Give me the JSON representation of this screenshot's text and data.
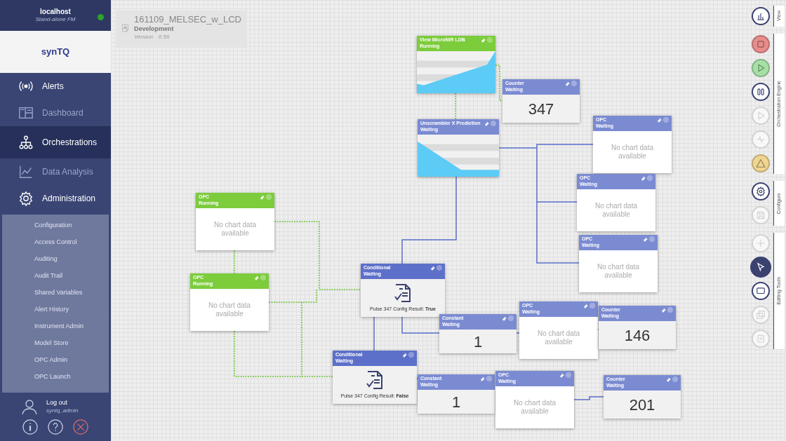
{
  "sidebar": {
    "host": {
      "name": "localhost",
      "mode": "Stand-alone FM",
      "online": true
    },
    "logo": "synTQ",
    "nav": [
      {
        "label": "Alerts",
        "kind": "alerts",
        "selected": false,
        "dim": false
      },
      {
        "label": "Dashboard",
        "kind": "dashboard",
        "selected": false,
        "dim": true
      },
      {
        "label": "Orchestrations",
        "kind": "orchestrations",
        "selected": true,
        "dim": false
      },
      {
        "label": "Data Analysis",
        "kind": "analysis",
        "selected": false,
        "dim": true
      },
      {
        "label": "Administration",
        "kind": "admin",
        "selected": false,
        "dim": false
      }
    ],
    "submenu": [
      "Configuration",
      "Access Control",
      "Auditing",
      "Audit Trail",
      "Shared Variables",
      "Alert History",
      "Instrument Admin",
      "Model Store",
      "OPC Admin",
      "OPC Launch"
    ],
    "user": {
      "action": "Log out",
      "name": "syntq_admin"
    }
  },
  "document": {
    "title": "161109_MELSEC_w_LCD",
    "stage": "Development",
    "version_label": "Version",
    "version": "0.56"
  },
  "nodes": [
    {
      "kind": "risingchart",
      "title": "View MicroNIR LDB",
      "status": "Running",
      "running": true
    },
    {
      "kind": "value",
      "title": "Counter",
      "status": "Waiting",
      "running": false,
      "value": "347"
    },
    {
      "kind": "fallingchart",
      "title": "Unscrambler X Prediction",
      "status": "Waiting",
      "running": false
    },
    {
      "kind": "empty",
      "title": "OPC",
      "status": "Waiting",
      "running": false,
      "message": "No chart data available"
    },
    {
      "kind": "empty",
      "title": "OPC",
      "status": "Waiting",
      "running": false,
      "message": "No chart data available"
    },
    {
      "kind": "empty",
      "title": "OPC",
      "status": "Running",
      "running": true,
      "message": "No chart data available"
    },
    {
      "kind": "empty",
      "title": "OPC",
      "status": "Waiting",
      "running": false,
      "message": "No chart data available"
    },
    {
      "kind": "empty",
      "title": "OPC",
      "status": "Running",
      "running": true,
      "message": "No chart data available"
    },
    {
      "kind": "conditional",
      "title": "Conditional",
      "status": "Waiting",
      "running": false,
      "result": "Pulse 347 Config Result: **True**"
    },
    {
      "kind": "value",
      "title": "Constant",
      "status": "Waiting",
      "running": false,
      "value": "1"
    },
    {
      "kind": "empty",
      "title": "OPC",
      "status": "Waiting",
      "running": false,
      "message": "No chart data available"
    },
    {
      "kind": "value",
      "title": "Counter",
      "status": "Waiting",
      "running": false,
      "value": "146"
    },
    {
      "kind": "conditional",
      "title": "Conditional",
      "status": "Waiting",
      "running": false,
      "result": "Pulse 347 Config Result: **False**"
    },
    {
      "kind": "value",
      "title": "Constant",
      "status": "Waiting",
      "running": false,
      "value": "1"
    },
    {
      "kind": "empty",
      "title": "OPC",
      "status": "Waiting",
      "running": false,
      "message": "No chart data available"
    },
    {
      "kind": "value",
      "title": "Counter",
      "status": "Waiting",
      "running": false,
      "value": "201"
    }
  ],
  "toolbar": [
    {
      "label": "View",
      "tools": [
        {
          "kind": "chart",
          "disabled": false
        }
      ]
    },
    {
      "label": "Orchestration Engine",
      "tools": [
        {
          "kind": "stop",
          "color": "#e88c8c",
          "disabled": false
        },
        {
          "kind": "play",
          "color": "#a6e0a6",
          "disabled": false
        },
        {
          "kind": "pause",
          "disabled": false
        },
        {
          "kind": "play",
          "disabled": true
        },
        {
          "kind": "pulse",
          "disabled": true
        },
        {
          "kind": "warning",
          "color": "#f0d592",
          "disabled": false
        }
      ]
    },
    {
      "label": "Configure",
      "tools": [
        {
          "kind": "gear",
          "disabled": false
        },
        {
          "kind": "save",
          "disabled": true
        }
      ]
    },
    {
      "label": "Editing Tools",
      "tools": [
        {
          "kind": "plus",
          "disabled": true,
          "selected": false
        },
        {
          "kind": "pointer",
          "disabled": false,
          "selected": true
        },
        {
          "kind": "rect",
          "disabled": false,
          "selected": false
        },
        {
          "kind": "copy",
          "disabled": true,
          "selected": false
        },
        {
          "kind": "paste",
          "disabled": true,
          "selected": false
        }
      ]
    }
  ]
}
